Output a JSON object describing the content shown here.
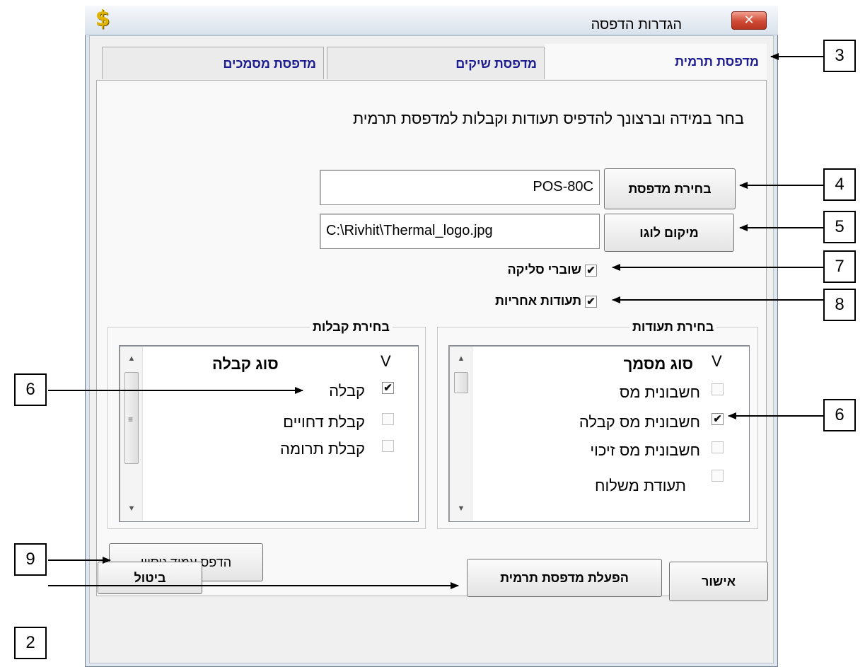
{
  "window": {
    "title": "הגדרות הדפסה",
    "app_icon": "$",
    "close_icon": "✕"
  },
  "tabs": [
    {
      "label": "מדפסת תרמית",
      "active": true
    },
    {
      "label": "מדפסת שיקים",
      "active": false
    },
    {
      "label": "מדפסת מסמכים",
      "active": false
    }
  ],
  "instruction": "בחר במידה וברצונך להדפיס תעודות וקבלות למדפסת תרמית",
  "printer": {
    "button_label": "בחירת מדפסת",
    "value": "POS-80C"
  },
  "logo": {
    "button_label": "מיקום לוגו",
    "value": "C:\\Rivhit\\Thermal_logo.jpg"
  },
  "options": [
    {
      "label": "שוברי סליקה",
      "checked": true
    },
    {
      "label": "תעודות אחריות",
      "checked": true
    }
  ],
  "documents_group": {
    "title": "בחירת תעודות",
    "col_check": "V",
    "col_type": "סוג מסמך",
    "items": [
      {
        "label": "חשבונית מס",
        "checked": false
      },
      {
        "label": "חשבונית מס קבלה",
        "checked": true
      },
      {
        "label": "חשבונית מס זיכוי",
        "checked": false
      },
      {
        "label": "תעודת משלוח",
        "checked": false
      }
    ]
  },
  "receipts_group": {
    "title": "בחירת קבלות",
    "col_check": "V",
    "col_type": "סוג קבלה",
    "items": [
      {
        "label": "קבלה",
        "checked": true
      },
      {
        "label": "קבלת דחויים",
        "checked": false
      },
      {
        "label": "קבלת תרומה",
        "checked": false
      }
    ]
  },
  "test_print_label": "הדפס עמוד ניסיון",
  "footer": {
    "ok_label": "אישור",
    "activate_label": "הפעלת מדפסת תרמית",
    "cancel_label": "ביטול"
  },
  "check_mark": "✔",
  "scroll_up": "▲",
  "scroll_down": "▼",
  "callouts": {
    "tabs": "3",
    "printer": "4",
    "logo": "5",
    "list_docs": "6",
    "list_receipts": "6",
    "slips": "7",
    "warranty": "8",
    "test_print": "9",
    "activate": "2"
  }
}
